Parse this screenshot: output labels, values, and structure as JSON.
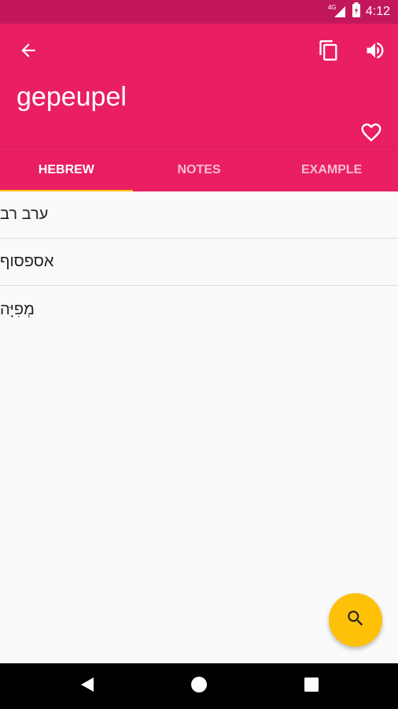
{
  "status_bar": {
    "time": "4:12",
    "network_label": "4G",
    "icons": [
      "signal-icon",
      "battery-icon"
    ]
  },
  "appbar": {
    "word": "gepeupel",
    "icons": [
      "back-arrow-icon",
      "copy-icon",
      "volume-icon",
      "heart-outline-icon"
    ]
  },
  "tabs": [
    {
      "label": "HEBREW",
      "active": true
    },
    {
      "label": "NOTES",
      "active": false
    },
    {
      "label": "EXAMPLE",
      "active": false
    }
  ],
  "translations": [
    "ערב רב",
    "אספסוף",
    "מְפִיָּה"
  ],
  "fab": {
    "icon": "search-icon"
  },
  "nav_bar": {
    "icons": [
      "nav-back-icon",
      "nav-home-icon",
      "nav-recent-icon"
    ]
  },
  "colors": {
    "primary": "#e91e63",
    "status_bar": "#c2185b",
    "accent": "#ffc107"
  }
}
